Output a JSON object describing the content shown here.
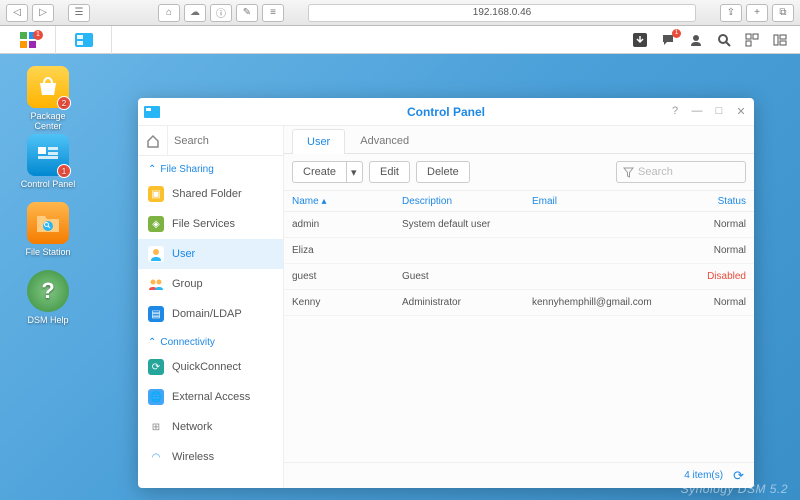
{
  "browser": {
    "address": "192.168.0.46"
  },
  "dsm": {
    "taskbar_badge": "1",
    "chat_badge": "1",
    "brand": "Synology DSM 5.2"
  },
  "desktop_icons": {
    "package": {
      "label": "Package Center",
      "badge": "2"
    },
    "cp": {
      "label": "Control Panel",
      "badge": "1"
    },
    "fs": {
      "label": "File Station"
    },
    "help": {
      "label": "DSM Help"
    }
  },
  "window": {
    "title": "Control Panel",
    "search_placeholder": "Search",
    "section1": "File Sharing",
    "section2": "Connectivity",
    "items": {
      "shared": "Shared Folder",
      "fileserv": "File Services",
      "user": "User",
      "group": "Group",
      "domain": "Domain/LDAP",
      "quick": "QuickConnect",
      "ext": "External Access",
      "net": "Network",
      "wifi": "Wireless"
    },
    "tabs": {
      "user": "User",
      "adv": "Advanced"
    },
    "buttons": {
      "create": "Create",
      "edit": "Edit",
      "delete": "Delete"
    },
    "filter_placeholder": "Search",
    "cols": {
      "name": "Name",
      "desc": "Description",
      "email": "Email",
      "status": "Status"
    },
    "rows": [
      {
        "name": "admin",
        "desc": "System default user",
        "email": "",
        "status": "Normal",
        "status_class": ""
      },
      {
        "name": "Eliza",
        "desc": "",
        "email": "",
        "status": "Normal",
        "status_class": ""
      },
      {
        "name": "guest",
        "desc": "Guest",
        "email": "",
        "status": "Disabled",
        "status_class": "disabled-st"
      },
      {
        "name": "Kenny",
        "desc": "Administrator",
        "email": "kennyhemphill@gmail.com",
        "status": "Normal",
        "status_class": ""
      }
    ],
    "footer_count": "4 item(s)"
  }
}
